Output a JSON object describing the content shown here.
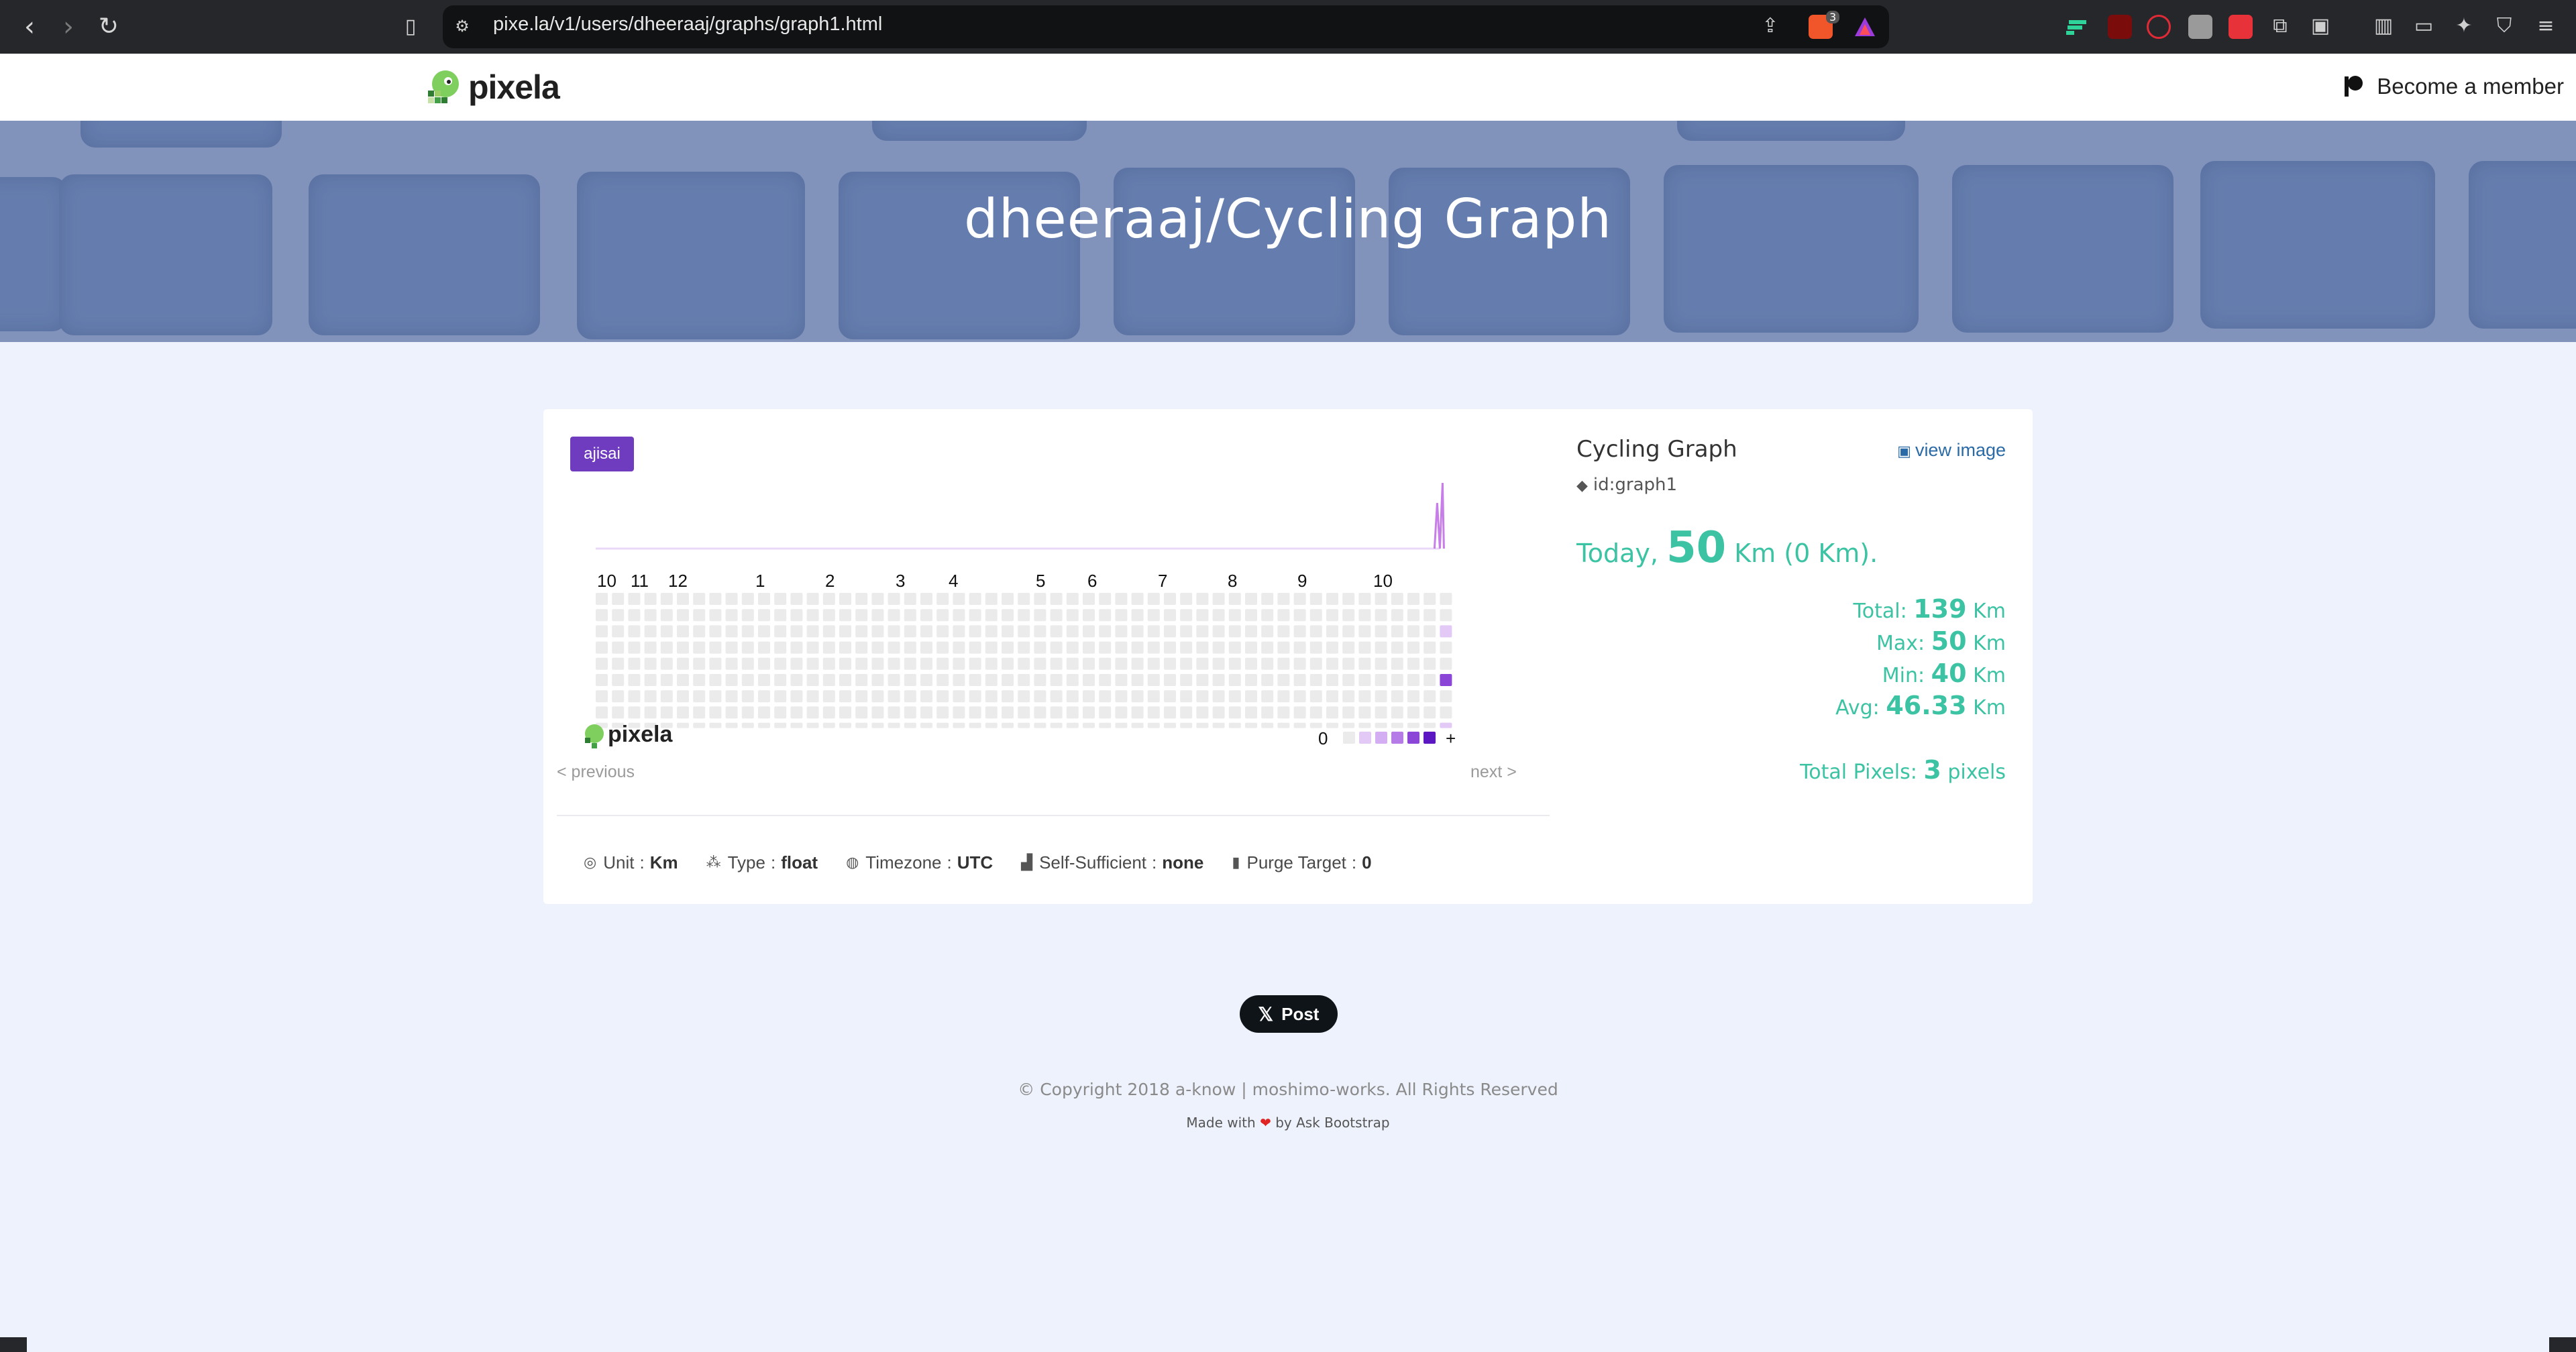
{
  "browser": {
    "url": "pixe.la/v1/users/dheeraaj/graphs/graph1.html",
    "shield_count": "3"
  },
  "header": {
    "logo_text": "pixela",
    "member_label": "Become a member"
  },
  "hero": {
    "title": "dheeraaj/Cycling Graph"
  },
  "graph": {
    "theme_badge": "ajisai",
    "months": [
      "10",
      "11",
      "12",
      "1",
      "2",
      "3",
      "4",
      "5",
      "6",
      "7",
      "8",
      "9",
      "10"
    ],
    "legend_zero": "0",
    "legend_plus": "+",
    "logo_text": "pixela",
    "prev_label": "< previous",
    "next_label": "next >",
    "pixels": [
      {
        "week_from_end": 0,
        "weekday": 2,
        "level": 1
      },
      {
        "week_from_end": 0,
        "weekday": 5,
        "level": 4
      },
      {
        "week_from_end": 0,
        "weekday": 8,
        "level": 1
      }
    ],
    "colors": {
      "empty": "#ebebeb",
      "level1": "#e2c9f6",
      "level2": "#d3aef2",
      "level3": "#b57be6",
      "level4": "#8b46d8",
      "level5": "#5b18c2",
      "line": "#c77ee8"
    }
  },
  "meta": {
    "unit_label": "Unit",
    "unit_value": "Km",
    "type_label": "Type",
    "type_value": "float",
    "timezone_label": "Timezone",
    "timezone_value": "UTC",
    "selfsufficient_label": "Self-Sufficient",
    "selfsufficient_value": "none",
    "purge_label": "Purge Target",
    "purge_value": "0",
    "separator": ":"
  },
  "side": {
    "title": "Cycling Graph",
    "view_image": "view image",
    "graph_id": "id:graph1",
    "today_prefix": "Today,",
    "today_value": "50",
    "today_suffix": "Km (0 Km).",
    "total_label": "Total:",
    "total_value": "139",
    "max_label": "Max:",
    "max_value": "50",
    "min_label": "Min:",
    "min_value": "40",
    "avg_label": "Avg:",
    "avg_value": "46.33",
    "unit": "Km",
    "pixels_label": "Total Pixels:",
    "pixels_value": "3",
    "pixels_unit": "pixels"
  },
  "footer": {
    "post_label": "Post",
    "copyright": "© Copyright 2018 a-know | moshimo-works. All Rights Reserved",
    "made_with": "Made with",
    "by": "by Ask Bootstrap",
    "accent": "#3cc3a3"
  }
}
